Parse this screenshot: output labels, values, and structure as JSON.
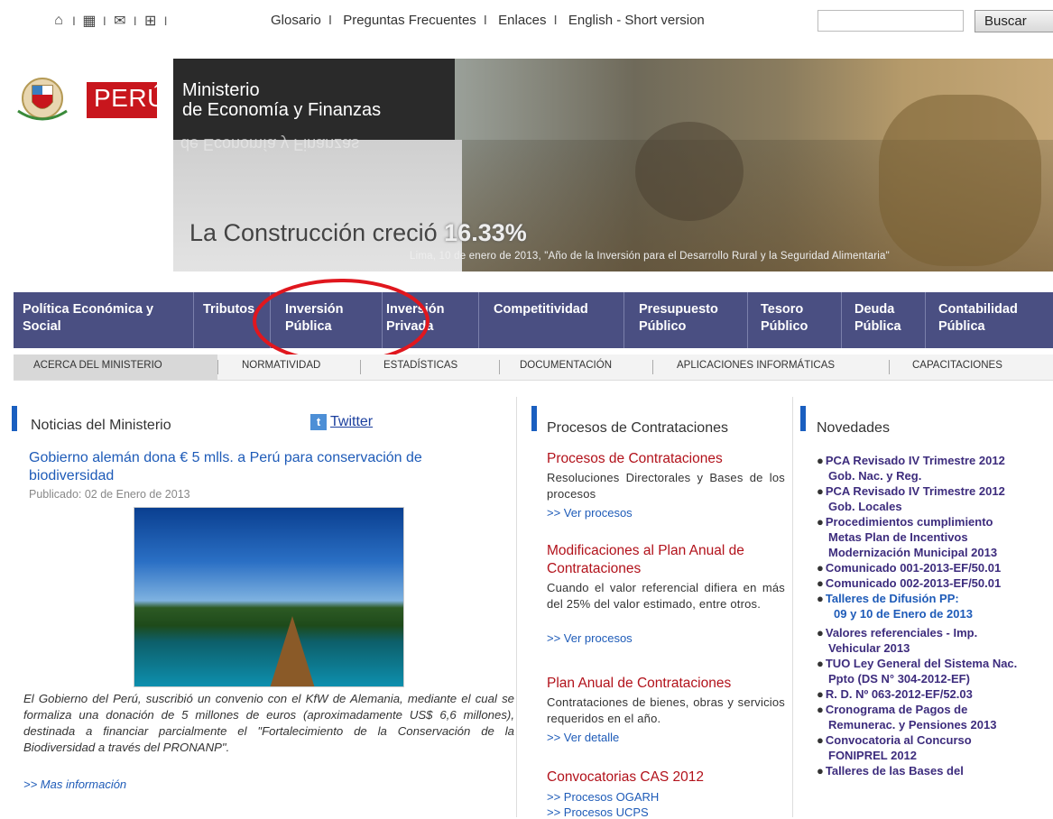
{
  "topbar": {
    "icons": [
      "home-icon",
      "sitemap-icon",
      "mail-icon",
      "network-icon"
    ],
    "links": [
      "Glosario",
      "Preguntas Frecuentes",
      "Enlaces",
      "English - Short version"
    ],
    "search_placeholder": "",
    "search_button": "Buscar"
  },
  "banner": {
    "peru": "PERÚ",
    "ministry_line1": "Ministerio",
    "ministry_line2": "de Economía y Finanzas",
    "reflection": "de Economía y Finanzas",
    "headline": "La Construcción creció",
    "headline_value": "16.33%",
    "dateline": "Lima, 10 de enero de 2013,   \"Año de la Inversión para el Desarrollo Rural y la Seguridad Alimentaria\""
  },
  "mainnav": [
    {
      "label": "Política Económica y Social"
    },
    {
      "label": "Tributos"
    },
    {
      "label": "Inversión Pública"
    },
    {
      "label": "Inversión Privada"
    },
    {
      "label": "Competitividad"
    },
    {
      "label": "Presupuesto Público"
    },
    {
      "label": "Tesoro Público"
    },
    {
      "label": "Deuda Pública"
    },
    {
      "label": "Contabilidad Pública"
    }
  ],
  "subnav": [
    "ACERCA DEL MINISTERIO",
    "NORMATIVIDAD",
    "ESTADÍSTICAS",
    "DOCUMENTACIÓN",
    "APLICACIONES INFORMÁTICAS",
    "CAPACITACIONES"
  ],
  "news": {
    "heading": "Noticias del Ministerio",
    "twitter": "Twitter",
    "title": "Gobierno alemán dona € 5 mlls. a Perú para conservación de biodiversidad",
    "date": "Publicado: 02 de Enero de 2013",
    "body": "El Gobierno del Perú, suscribió un convenio con el KfW de Alemania, mediante el cual se formaliza una donación de 5 millones de euros (aproximadamente US$ 6,6 millones), destinada a financiar parcialmente el \"Fortalecimiento de la Conservación de la Biodiversidad a través del PRONANP\".",
    "more": ">> Mas información"
  },
  "procesos": {
    "heading": "Procesos de Contrataciones",
    "items": [
      {
        "title": "Procesos de Contrataciones",
        "text": "Resoluciones Directorales y Bases de los procesos",
        "link": ">> Ver procesos"
      },
      {
        "title": "Modificaciones al Plan Anual de Contrataciones",
        "text": "Cuando el valor referencial difiera en más del 25% del valor estimado, entre otros.",
        "link": ">> Ver procesos"
      },
      {
        "title": "Plan Anual de Contrataciones",
        "text": "Contrataciones de bienes, obras y servicios requeridos en el año.",
        "link": ">> Ver detalle"
      },
      {
        "title": "Convocatorias CAS 2012",
        "text": "",
        "link": ">> Procesos OGARH"
      }
    ],
    "extra_link": ">> Procesos UCPS"
  },
  "novedades": {
    "heading": "Novedades",
    "lines": [
      "PCA Revisado IV Trimestre 2012",
      "Gob. Nac. y Reg.",
      "PCA Revisado IV Trimestre 2012",
      "Gob.  Locales",
      "Procedimientos cumplimiento",
      "Metas Plan de Incentivos",
      "Modernización Municipal 2013",
      "Comunicado 001-2013-EF/50.01",
      "Comunicado 002-2013-EF/50.01",
      "Talleres de Difusión PP:",
      "09 y 10 de Enero de 2013",
      "Valores referenciales - Imp.",
      "Vehicular 2013",
      "TUO Ley General del Sistema Nac.",
      "Ppto (DS N° 304-2012-EF)",
      "R. D. Nº 063-2012-EF/52.03",
      "Cronograma de Pagos de",
      "Remunerac. y Pensiones 2013",
      "Convocatoria al Concurso",
      "FONIPREL 2012",
      "Talleres de las Bases del"
    ]
  },
  "colors": {
    "nav": "#4a4f82",
    "news_link": "#1e5bb8",
    "proc_title": "#b2121b",
    "novedades": "#3d2c7d",
    "highlight_circle": "#e0171e"
  }
}
